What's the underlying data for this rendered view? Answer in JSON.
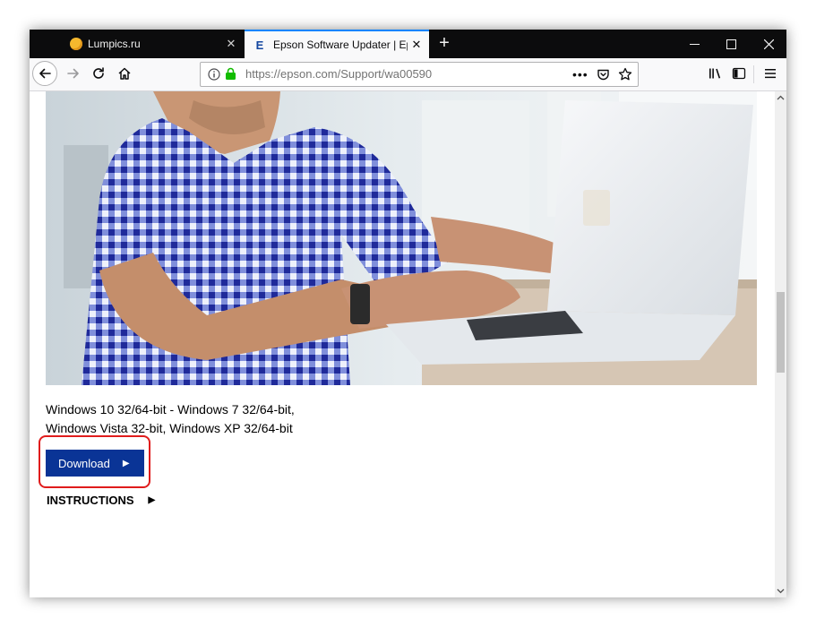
{
  "tabs": [
    {
      "title": "Lumpics.ru",
      "active": false
    },
    {
      "title": "Epson Software Updater | Epson",
      "active": true
    }
  ],
  "address_bar": {
    "url": "https://epson.com/Support/wa00590"
  },
  "content": {
    "os_line1": "Windows 10 32/64-bit - Windows 7 32/64-bit,",
    "os_line2": "Windows Vista 32-bit, Windows XP 32/64-bit",
    "download_label": "Download",
    "instructions_label": "INSTRUCTIONS"
  },
  "colors": {
    "accent": "#0a84ff",
    "download_button": "#0a3496",
    "highlight_box": "#e01c1c"
  }
}
